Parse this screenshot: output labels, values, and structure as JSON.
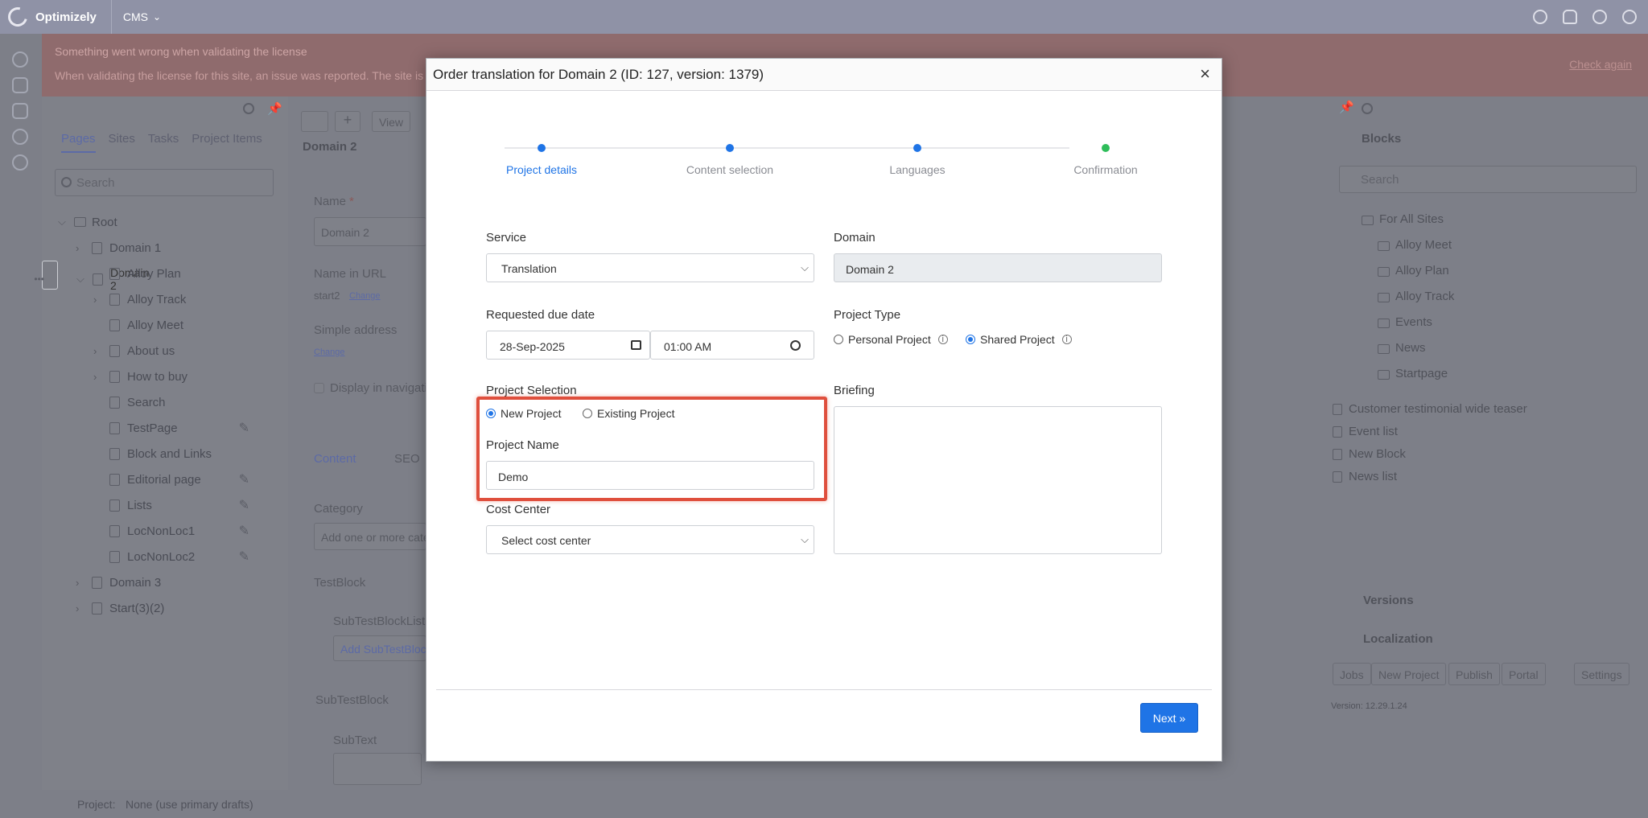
{
  "topbar": {
    "brand": "Optimizely",
    "product": "CMS",
    "product_caret": "⌄"
  },
  "alert": {
    "title": "Something went wrong when validating the license",
    "message": "When validating the license for this site, an issue was reported. The site is not currently licensed.",
    "check_again": "Check again"
  },
  "navigation": {
    "tabs": [
      "Pages",
      "Sites",
      "Tasks",
      "Project Items"
    ],
    "search_placeholder": "Search",
    "tree": [
      {
        "label": "Root",
        "chev": "⌵",
        "icon": "folder-icon"
      },
      {
        "label": "Domain 1",
        "chev": "›",
        "icon": "home-icon"
      },
      {
        "label": "Domain 2",
        "chev": "⌵",
        "icon": "home-icon",
        "more": "•••"
      },
      {
        "label": "Alloy Plan",
        "chev": "",
        "icon": "page-icon"
      },
      {
        "label": "Alloy Track",
        "chev": "›",
        "icon": "page-icon"
      },
      {
        "label": "Alloy Meet",
        "chev": "",
        "icon": "page-icon"
      },
      {
        "label": "About us",
        "chev": "›",
        "icon": "page-icon"
      },
      {
        "label": "How to buy",
        "chev": "›",
        "icon": "page-icon"
      },
      {
        "label": "Search",
        "chev": "",
        "icon": "page-icon"
      },
      {
        "label": "TestPage",
        "chev": "",
        "icon": "page-icon",
        "edit": "✎"
      },
      {
        "label": "Block and Links",
        "chev": "",
        "icon": "page-icon"
      },
      {
        "label": "Editorial page",
        "chev": "",
        "icon": "page-icon",
        "edit": "✎"
      },
      {
        "label": "Lists",
        "chev": "",
        "icon": "page-icon",
        "edit": "✎"
      },
      {
        "label": "LocNonLoc1",
        "chev": "",
        "icon": "page-icon",
        "edit": "✎"
      },
      {
        "label": "LocNonLoc2",
        "chev": "",
        "icon": "page-icon",
        "edit": "✎"
      },
      {
        "label": "Domain 3",
        "chev": "›",
        "icon": "home-icon"
      },
      {
        "label": "Start(3)(2)",
        "chev": "›",
        "icon": "page-icon"
      }
    ]
  },
  "statusbar": {
    "project_label": "Project:",
    "project_value": "None (use primary drafts)"
  },
  "editor": {
    "view_button": "View",
    "page_title": "Domain 2",
    "name_label": "Name",
    "required_mark": "*",
    "name_value": "Domain 2",
    "name_in_url_label": "Name in URL",
    "name_in_url_value": "start2",
    "change_link": "Change",
    "simple_address_label": "Simple address",
    "display_in_nav": "Display in navigation",
    "content_tab": "Content",
    "seo_tab": "SEO",
    "category_label": "Category",
    "category_placeholder": "Add one or more categories",
    "testblock_label": "TestBlock",
    "subtestblocklist_label": "SubTestBlockList",
    "add_subtest": "Add SubTestBlock",
    "subtestblock_label": "SubTestBlock",
    "subtext_label": "SubText"
  },
  "assets": {
    "blocks_title": "Blocks",
    "search_placeholder": "Search",
    "folders": [
      "For All Sites",
      "Alloy Meet",
      "Alloy Plan",
      "Alloy Track",
      "Events",
      "News",
      "Startpage"
    ],
    "blocks": [
      "Customer testimonial wide teaser",
      "Event list",
      "New Block",
      "News list"
    ],
    "versions": "Versions",
    "localization": "Localization",
    "loc_buttons": [
      "Jobs",
      "New Project",
      "Publish",
      "Portal",
      "Settings"
    ],
    "version_text": "Version: 12.29.1.24"
  },
  "dialog": {
    "title": "Order translation for Domain 2 (ID: 127, version: 1379)",
    "close": "×",
    "steps": [
      "Project details",
      "Content selection",
      "Languages",
      "Confirmation"
    ],
    "service_label": "Service",
    "service_value": "Translation",
    "domain_label": "Domain",
    "domain_value": "Domain 2",
    "due_date_label": "Requested due date",
    "due_date_value": "28-Sep-2025",
    "due_time_value": "01:00 AM",
    "project_type_label": "Project Type",
    "project_type_options": [
      "Personal Project",
      "Shared Project"
    ],
    "project_type_selected": "Shared Project",
    "project_selection_label": "Project Selection",
    "project_selection_options": [
      "New Project",
      "Existing Project"
    ],
    "project_selection_selected": "New Project",
    "project_name_label": "Project Name",
    "project_name_value": "Demo",
    "briefing_label": "Briefing",
    "cost_center_label": "Cost Center",
    "cost_center_value": "Select cost center",
    "next_button": "Next »",
    "info_glyph": "i",
    "colors": {
      "primary": "#1f74e6",
      "highlight": "#df4f3d",
      "step_done": "#2ebd5a"
    }
  }
}
